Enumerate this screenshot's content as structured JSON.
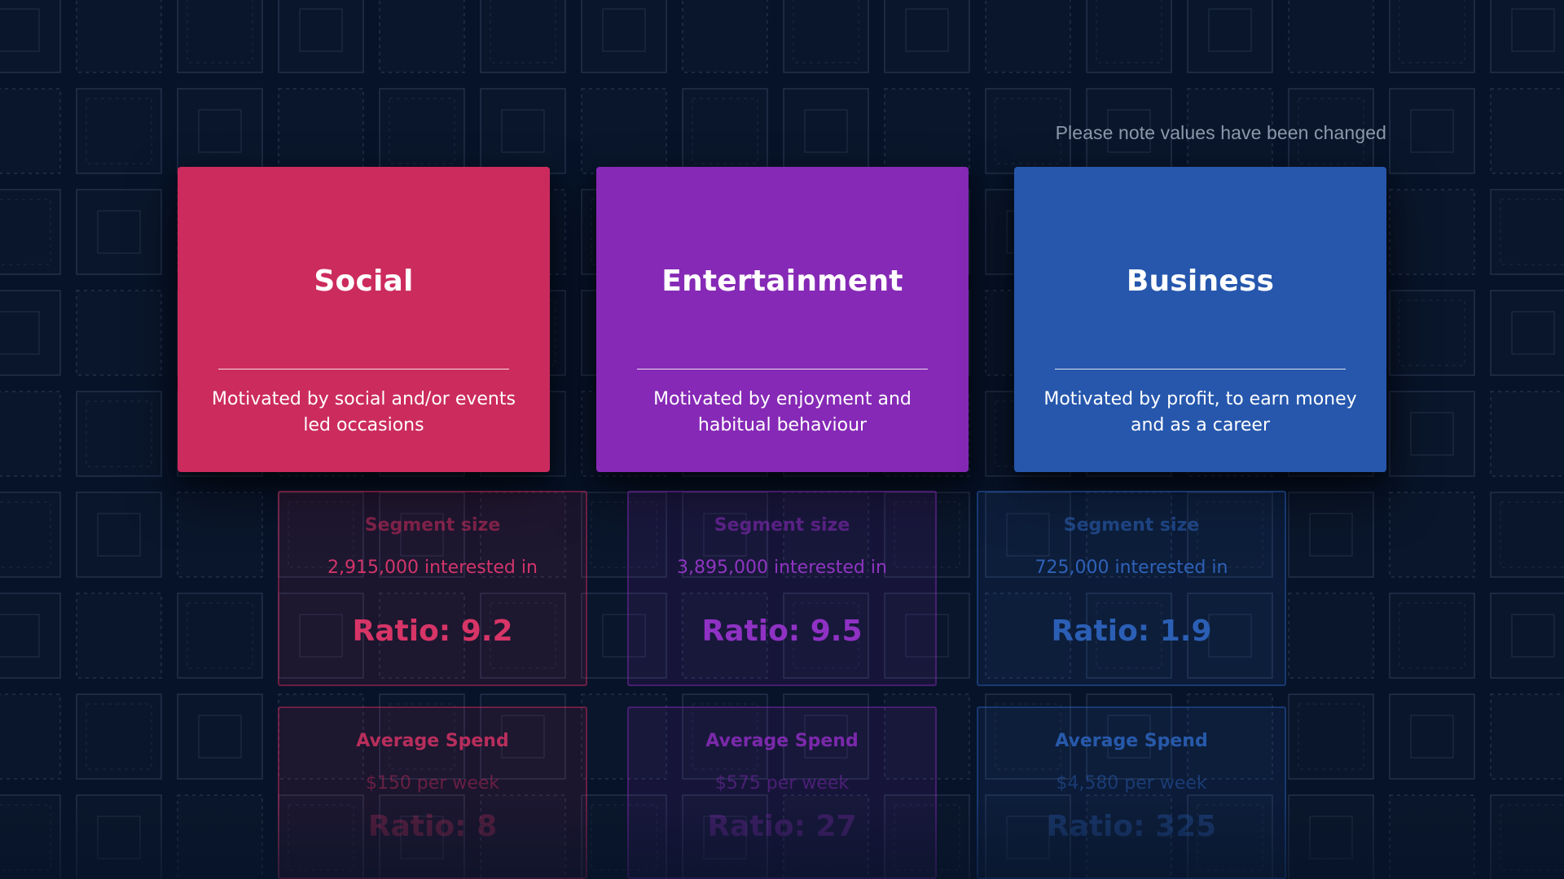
{
  "note": "Please note values have been changed",
  "segments": [
    {
      "title": "Social",
      "description": "Motivated by social and/or events led occasions",
      "segment_size": {
        "heading": "Segment size",
        "value": "2,915,000 interested in",
        "ratio": "Ratio: 9.2"
      },
      "average_spend": {
        "heading": "Average Spend",
        "value": "$150 per week",
        "ratio": "Ratio: 8"
      },
      "color": "#cc2b5e"
    },
    {
      "title": "Entertainment",
      "description": "Motivated by enjoyment and habitual behaviour",
      "segment_size": {
        "heading": "Segment size",
        "value": "3,895,000 interested in",
        "ratio": "Ratio: 9.5"
      },
      "average_spend": {
        "heading": "Average Spend",
        "value": "$575 per week",
        "ratio": "Ratio: 27"
      },
      "color": "#8629b6"
    },
    {
      "title": "Business",
      "description": "Motivated by profit, to earn money and as a career",
      "segment_size": {
        "heading": "Segment size",
        "value": "725,000 interested in",
        "ratio": "Ratio: 1.9"
      },
      "average_spend": {
        "heading": "Average Spend",
        "value": "$4,580 per week",
        "ratio": "Ratio: 325"
      },
      "color": "#2657ad"
    }
  ]
}
